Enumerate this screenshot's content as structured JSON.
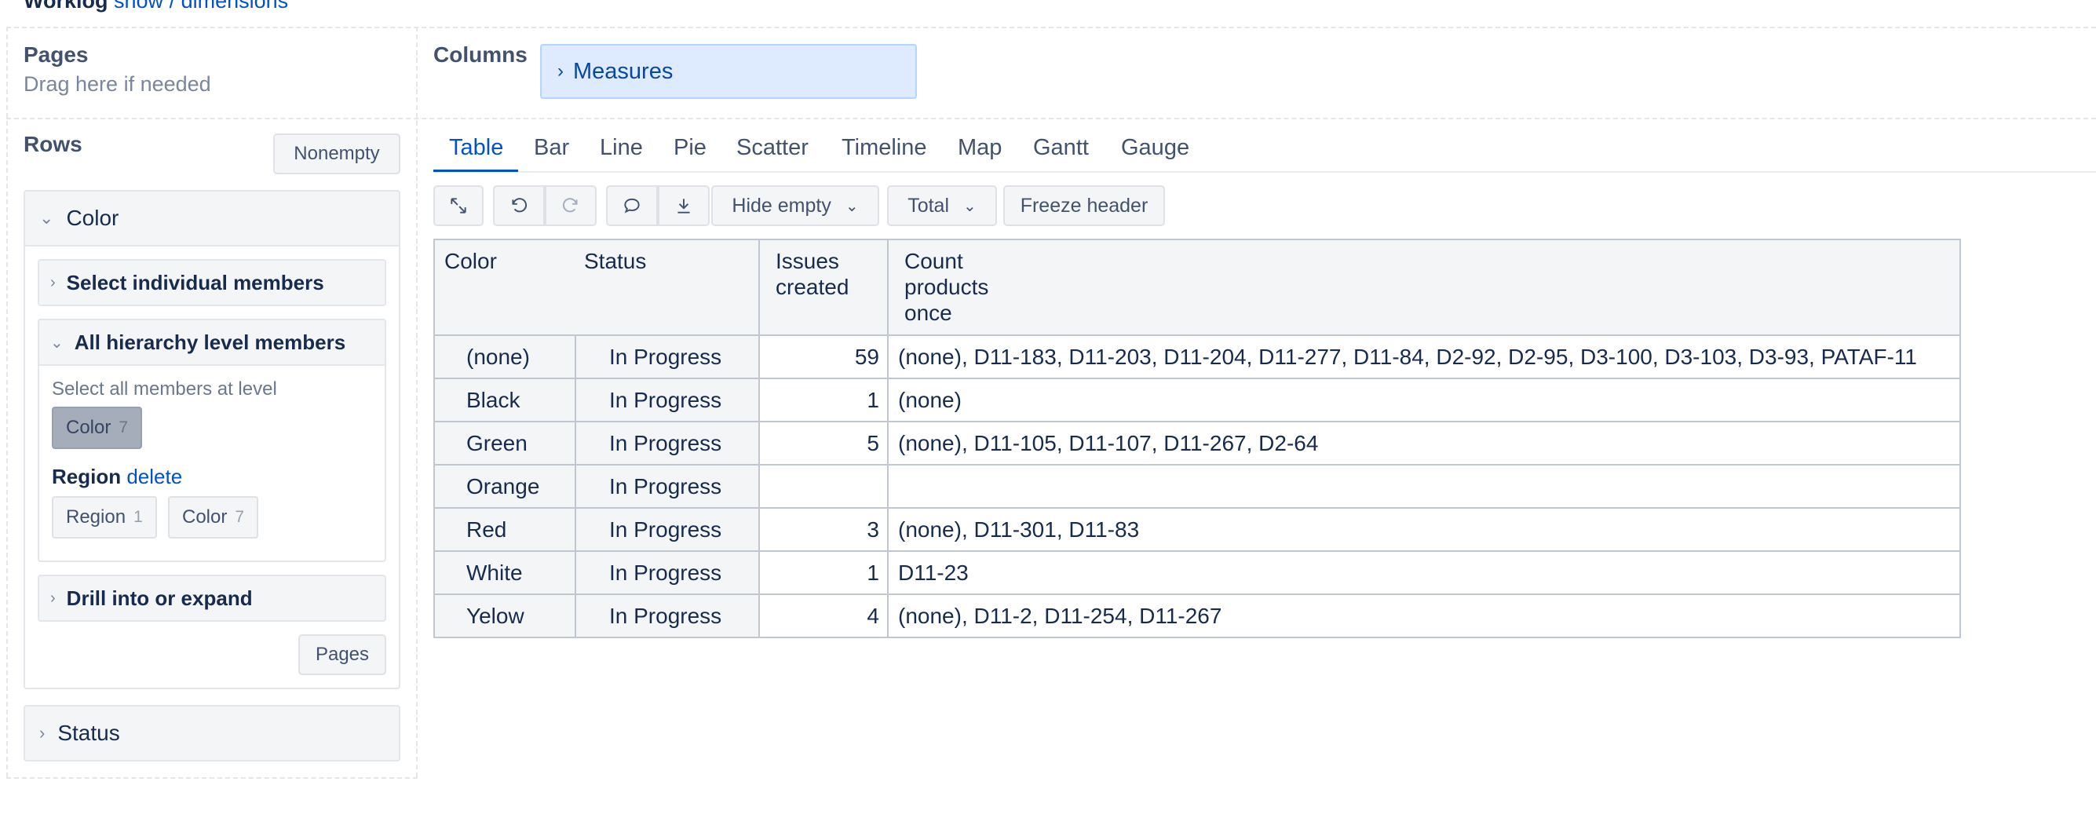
{
  "header": {
    "title": "Worklog",
    "links": [
      "show",
      "/",
      "dimensions"
    ]
  },
  "pages": {
    "title": "Pages",
    "hint": "Drag here if needed"
  },
  "columns": {
    "title": "Columns",
    "measures_label": "Measures"
  },
  "rows": {
    "title": "Rows",
    "nonempty_label": "Nonempty",
    "color_panel": {
      "title": "Color",
      "select_individual": "Select individual members",
      "all_hierarchy": "All hierarchy level members",
      "select_all_hint": "Select all members at level",
      "level_chip": {
        "label": "Color",
        "count": "7"
      },
      "region": {
        "label": "Region",
        "delete": "delete"
      },
      "region_chips": [
        {
          "label": "Region",
          "count": "1"
        },
        {
          "label": "Color",
          "count": "7"
        }
      ],
      "drill": "Drill into or expand",
      "pages_button": "Pages"
    },
    "status_panel": {
      "title": "Status"
    }
  },
  "tabs": [
    "Table",
    "Bar",
    "Line",
    "Pie",
    "Scatter",
    "Timeline",
    "Map",
    "Gantt",
    "Gauge"
  ],
  "active_tab": "Table",
  "toolbar": {
    "hide_empty": "Hide empty",
    "total": "Total",
    "freeze_header": "Freeze header",
    "icons": [
      "expand-icon",
      "undo-icon",
      "redo-icon",
      "comment-icon",
      "download-icon"
    ]
  },
  "table": {
    "headers": {
      "color": "Color",
      "status": "Status",
      "issues_created": "Issues created",
      "count_products": "Count products once"
    },
    "rows": [
      {
        "color": "(none)",
        "status": "In Progress",
        "issues": "59",
        "products": "(none), D11-183, D11-203, D11-204, D11-277, D11-84, D2-92, D2-95, D3-100, D3-103, D3-93, PATAF-11"
      },
      {
        "color": "Black",
        "status": "In Progress",
        "issues": "1",
        "products": "(none)"
      },
      {
        "color": "Green",
        "status": "In Progress",
        "issues": "5",
        "products": "(none), D11-105, D11-107, D11-267, D2-64"
      },
      {
        "color": "Orange",
        "status": "In Progress",
        "issues": "",
        "products": ""
      },
      {
        "color": "Red",
        "status": "In Progress",
        "issues": "3",
        "products": "(none), D11-301, D11-83"
      },
      {
        "color": "White",
        "status": "In Progress",
        "issues": "1",
        "products": "D11-23"
      },
      {
        "color": "Yelow",
        "status": "In Progress",
        "issues": "4",
        "products": "(none), D11-2, D11-254, D11-267"
      }
    ]
  },
  "colors": {
    "accent": "#0052cc",
    "measures_bg": "#deebff",
    "panel_bg": "#f4f5f7"
  }
}
